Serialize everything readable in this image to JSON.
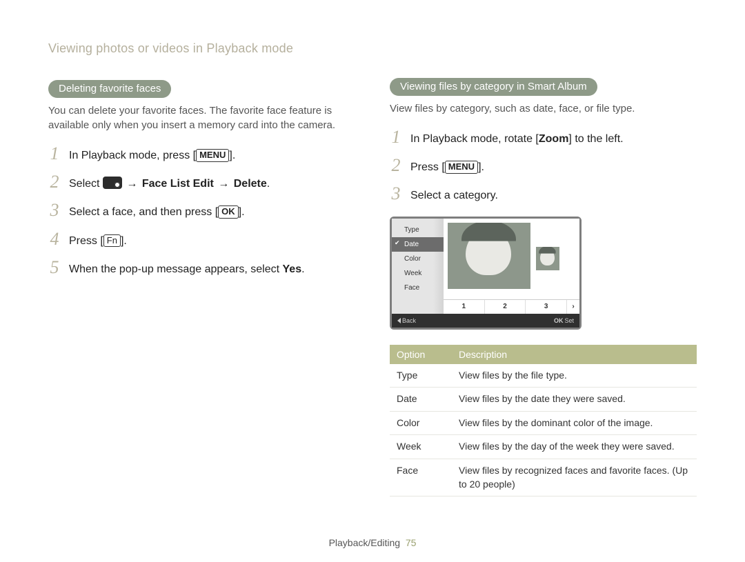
{
  "breadcrumb": "Viewing photos or videos in Playback mode",
  "left": {
    "heading": "Deleting favorite faces",
    "intro": "You can delete your favorite faces. The favorite face feature is available only when you insert a memory card into the camera.",
    "steps": {
      "s1a": "In Playback mode, press [",
      "s1btn": "MENU",
      "s1b": "].",
      "s2a": "Select ",
      "s2arrow1": " → ",
      "s2b": "Face List Edit",
      "s2arrow2": " → ",
      "s2c": "Delete",
      "s2d": ".",
      "s3a": "Select a face, and then press [",
      "s3btn": "OK",
      "s3b": "].",
      "s4a": "Press [",
      "s4btn": "Fn",
      "s4b": "].",
      "s5a": "When the pop-up message appears, select ",
      "s5b": "Yes",
      "s5c": "."
    }
  },
  "right": {
    "heading": "Viewing files by category in Smart Album",
    "intro": "View files by category, such as date, face, or file type.",
    "steps": {
      "s1a": "In Playback mode, rotate [",
      "s1bold": "Zoom",
      "s1b": "] to the left.",
      "s2a": "Press [",
      "s2btn": "MENU",
      "s2b": "].",
      "s3": "Select a category."
    },
    "menu": {
      "items": [
        "Type",
        "Date",
        "Color",
        "Week",
        "Face"
      ],
      "selected": "Date",
      "pager": [
        "1",
        "2",
        "3",
        "›"
      ],
      "footer_back": "Back",
      "footer_set": "Set"
    },
    "table": {
      "head_option": "Option",
      "head_desc": "Description",
      "rows": [
        {
          "opt": "Type",
          "desc": "View files by the file type."
        },
        {
          "opt": "Date",
          "desc": "View files by the date they were saved."
        },
        {
          "opt": "Color",
          "desc": "View files by the dominant color of the image."
        },
        {
          "opt": "Week",
          "desc": "View files by the day of the week they were saved."
        },
        {
          "opt": "Face",
          "desc": "View files by recognized faces and favorite faces. (Up to 20 people)"
        }
      ]
    }
  },
  "footer": {
    "section": "Playback/Editing",
    "page": "75"
  }
}
